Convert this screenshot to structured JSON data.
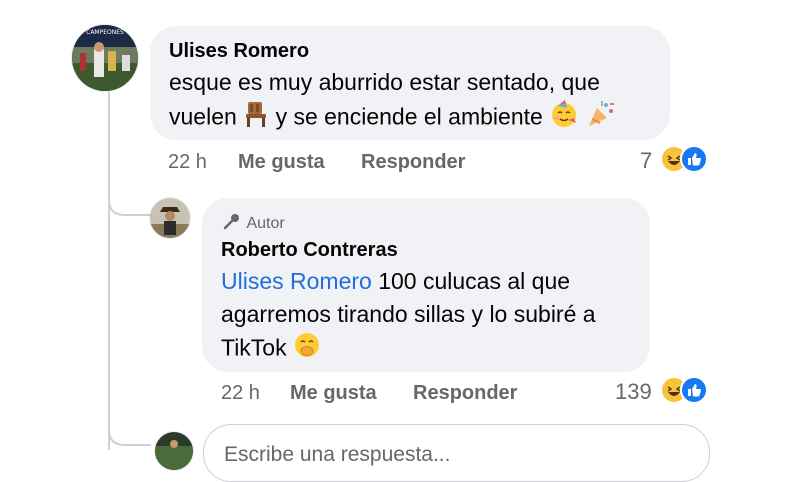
{
  "comment": {
    "author": "Ulises Romero",
    "text_line1": "esque es muy aburrido estar sentado, que",
    "text_line2_a": "vuelen",
    "text_line2_b": "y se enciende el ambiente",
    "emojis": [
      "chair-icon",
      "partying-face-icon",
      "party-popper-icon"
    ],
    "time": "22 h",
    "like_label": "Me gusta",
    "reply_label": "Responder",
    "reaction_count": "7",
    "reactions": [
      "haha-reaction-icon",
      "like-reaction-icon"
    ]
  },
  "reply": {
    "badge_label": "Autor",
    "author": "Roberto Contreras",
    "mention": "Ulises Romero",
    "text_line1": "100 culucas al que",
    "text_line2": "agarremos tirando sillas y lo subiré a",
    "text_line3": "TikTok",
    "emojis": [
      "face-with-hand-over-mouth-icon"
    ],
    "time": "22 h",
    "like_label": "Me gusta",
    "reply_label": "Responder",
    "reaction_count": "139",
    "reactions": [
      "haha-reaction-icon",
      "like-reaction-icon"
    ]
  },
  "reply_input": {
    "placeholder": "Escribe una respuesta..."
  },
  "colors": {
    "bubble": "#f0f2f5",
    "mention": "#216fdb",
    "meta": "#65676b",
    "like_blue": "#1877f2"
  }
}
